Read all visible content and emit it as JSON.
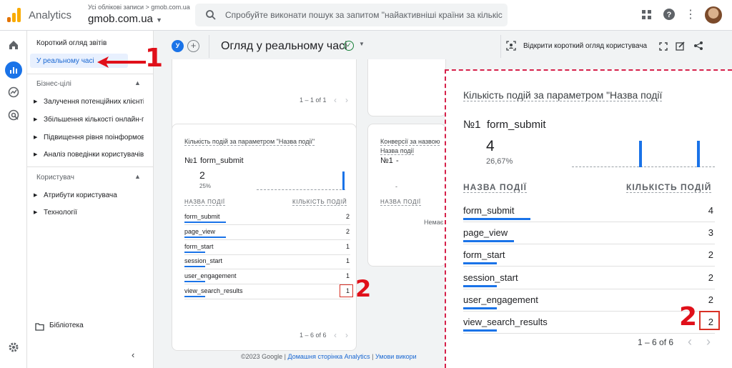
{
  "topbar": {
    "app_name": "Analytics",
    "account_path": "Усі облікові записи > gmob.com.ua",
    "property": "gmob.com.ua",
    "search_placeholder": "Спробуйте виконати пошук за запитом \"найактивніші країни за кількіст..."
  },
  "nav": {
    "overview": "Короткий огляд звітів",
    "realtime": "У реальному часі",
    "section_business": "Бізнес-цілі",
    "business_items": [
      "Залучення потенційних клієнтів",
      "Збільшення кількості онлайн-продажів",
      "Підвищення рівня поінформованості про бренд",
      "Аналіз поведінки користувачів"
    ],
    "section_user": "Користувач",
    "user_items": [
      "Атрибути користувача",
      "Технології"
    ],
    "library": "Бібліотека"
  },
  "page": {
    "user_badge": "У",
    "plus": "+",
    "title": "Огляд у реальному часі",
    "open_snapshot": "Відкрити короткий огляд користувача"
  },
  "top_card": {
    "pagination": "1 – 1 of 1"
  },
  "events_card": {
    "title": "Кількість подій за параметром \"Назва події\"",
    "top_rank": "№1",
    "top_name": "form_submit",
    "top_value": "2",
    "top_percent": "25%",
    "col_name": "НАЗВА ПОДІЇ",
    "col_count": "КІЛЬКІСТЬ ПОДІЙ",
    "rows": [
      {
        "name": "form_submit",
        "value": "2",
        "share": 1.0
      },
      {
        "name": "page_view",
        "value": "2",
        "share": 1.0
      },
      {
        "name": "form_start",
        "value": "1",
        "share": 0.5
      },
      {
        "name": "session_start",
        "value": "1",
        "share": 0.5
      },
      {
        "name": "user_engagement",
        "value": "1",
        "share": 0.5
      },
      {
        "name": "view_search_results",
        "value": "1",
        "share": 0.5
      }
    ],
    "pagination": "1 – 6 of 6"
  },
  "conversions_card": {
    "title_line1": "Конверсії за назвою",
    "title_line2": "Назва події",
    "top_rank": "№1",
    "top_name": "-",
    "col_name": "НАЗВА ПОДІЇ",
    "no_data": "Немає"
  },
  "zoom_card": {
    "title": "Кількість подій за параметром \"Назва події",
    "top_rank": "№1",
    "top_name": "form_submit",
    "top_value": "4",
    "top_percent": "26,67%",
    "col_name": "НАЗВА ПОДІЇ",
    "col_count": "КІЛЬКІСТЬ ПОДІЙ",
    "rows": [
      {
        "name": "form_submit",
        "value": "4",
        "share": 1.0
      },
      {
        "name": "page_view",
        "value": "3",
        "share": 0.75
      },
      {
        "name": "form_start",
        "value": "2",
        "share": 0.5
      },
      {
        "name": "session_start",
        "value": "2",
        "share": 0.5
      },
      {
        "name": "user_engagement",
        "value": "2",
        "share": 0.5
      },
      {
        "name": "view_search_results",
        "value": "2",
        "share": 0.5
      }
    ],
    "pagination": "1 – 6 of 6"
  },
  "footer": {
    "copyright": "©2023 Google | ",
    "home_link": "Домашня сторінка Analytics",
    "sep": " | ",
    "terms_link": "Умови викори"
  },
  "annotations": {
    "one": "1",
    "two_small": "2",
    "two_large": "2"
  },
  "colors": {
    "accent": "#1a73e8",
    "annotation_red": "#e0101a",
    "zoom_border": "#d6214a"
  }
}
